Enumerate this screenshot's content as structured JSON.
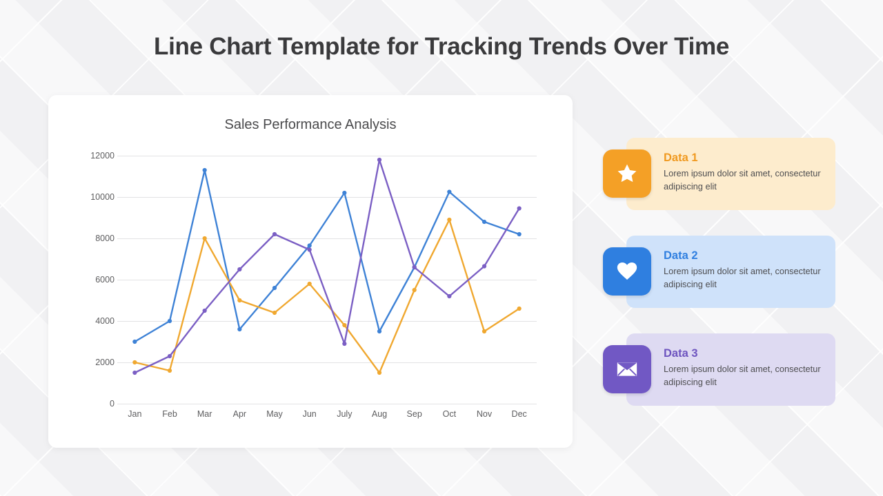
{
  "page": {
    "title": "Line Chart Template for Tracking Trends Over Time"
  },
  "colors": {
    "series_blue": "#3e82d6",
    "series_orange": "#f0a830",
    "series_purple": "#7b5fc4",
    "card1_bg": "#fdeccd",
    "card2_bg": "#cfe2fa",
    "card3_bg": "#dedaf2",
    "icon1_bg": "#f4a026",
    "icon2_bg": "#2f7fe0",
    "icon3_bg": "#7158c4"
  },
  "legend": {
    "cards": [
      {
        "title": "Data 1",
        "description": "Lorem ipsum dolor sit amet, consectetur adipiscing elit",
        "icon": "star-icon",
        "icon_color": "#f4a026",
        "card_color": "#fdeccd"
      },
      {
        "title": "Data 2",
        "description": "Lorem ipsum dolor sit amet, consectetur adipiscing elit",
        "icon": "heart-icon",
        "icon_color": "#2f7fe0",
        "card_color": "#cfe2fa"
      },
      {
        "title": "Data 3",
        "description": "Lorem ipsum dolor sit amet, consectetur adipiscing elit",
        "icon": "envelope-icon",
        "icon_color": "#7158c4",
        "card_color": "#dedaf2"
      }
    ]
  },
  "chart_data": {
    "type": "line",
    "title": "Sales Performance Analysis",
    "xlabel": "",
    "ylabel": "",
    "categories": [
      "Jan",
      "Feb",
      "Mar",
      "Apr",
      "May",
      "Jun",
      "July",
      "Aug",
      "Sep",
      "Oct",
      "Nov",
      "Dec"
    ],
    "ylim": [
      0,
      12000
    ],
    "yticks": [
      0,
      2000,
      4000,
      6000,
      8000,
      10000,
      12000
    ],
    "grid": true,
    "legend_position": "right-cards",
    "markers": true,
    "series": [
      {
        "name": "Data 2",
        "color": "#3e82d6",
        "values": [
          3000,
          4000,
          11300,
          3600,
          5600,
          7650,
          10200,
          3500,
          6600,
          10250,
          8800,
          8200
        ]
      },
      {
        "name": "Data 1",
        "color": "#f0a830",
        "values": [
          2000,
          1600,
          8000,
          5000,
          4400,
          5800,
          3800,
          1500,
          5500,
          8900,
          3500,
          4600
        ]
      },
      {
        "name": "Data 3",
        "color": "#7b5fc4",
        "values": [
          1500,
          2300,
          4500,
          6500,
          8200,
          7450,
          2900,
          11800,
          6600,
          5200,
          6650,
          9450
        ]
      }
    ]
  }
}
